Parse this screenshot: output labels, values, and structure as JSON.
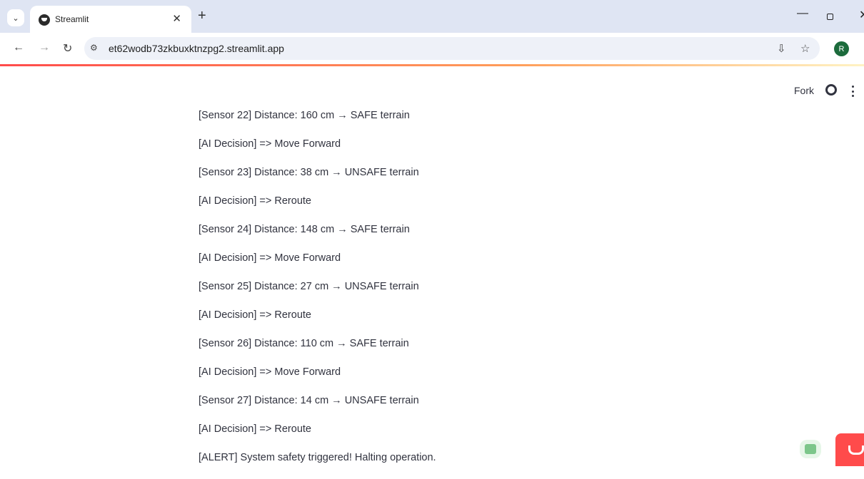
{
  "browser": {
    "tab_title": "Streamlit",
    "tab_close": "✕",
    "new_tab": "+",
    "url": "et62wodb73zkbuxktnzpg2.streamlit.app",
    "profile_initial": "R"
  },
  "streamlit_header": {
    "fork_label": "Fork"
  },
  "log_lines": [
    "[Sensor 22] Distance: 160 cm → SAFE terrain",
    "[AI Decision] => Move Forward",
    "[Sensor 23] Distance: 38 cm → UNSAFE terrain",
    "[AI Decision] => Reroute",
    "[Sensor 24] Distance: 148 cm → SAFE terrain",
    "[AI Decision] => Move Forward",
    "[Sensor 25] Distance: 27 cm → UNSAFE terrain",
    "[AI Decision] => Reroute",
    "[Sensor 26] Distance: 110 cm → SAFE terrain",
    "[AI Decision] => Move Forward",
    "[Sensor 27] Distance: 14 cm → UNSAFE terrain",
    "[AI Decision] => Reroute",
    "[ALERT] System safety triggered! Halting operation."
  ],
  "icons": {
    "tab_search": "chevron-down-icon",
    "favicon": "streamlit-icon",
    "back": "arrow-left-icon",
    "forward": "arrow-right-icon",
    "reload": "reload-icon",
    "site_info": "tune-icon",
    "install": "install-app-icon",
    "bookmark": "star-icon",
    "github": "github-icon",
    "menu": "kebab-menu-icon"
  },
  "colors": {
    "accent_start": "#ff4b4b",
    "text": "#31333f",
    "profile": "#1c6b3c"
  }
}
